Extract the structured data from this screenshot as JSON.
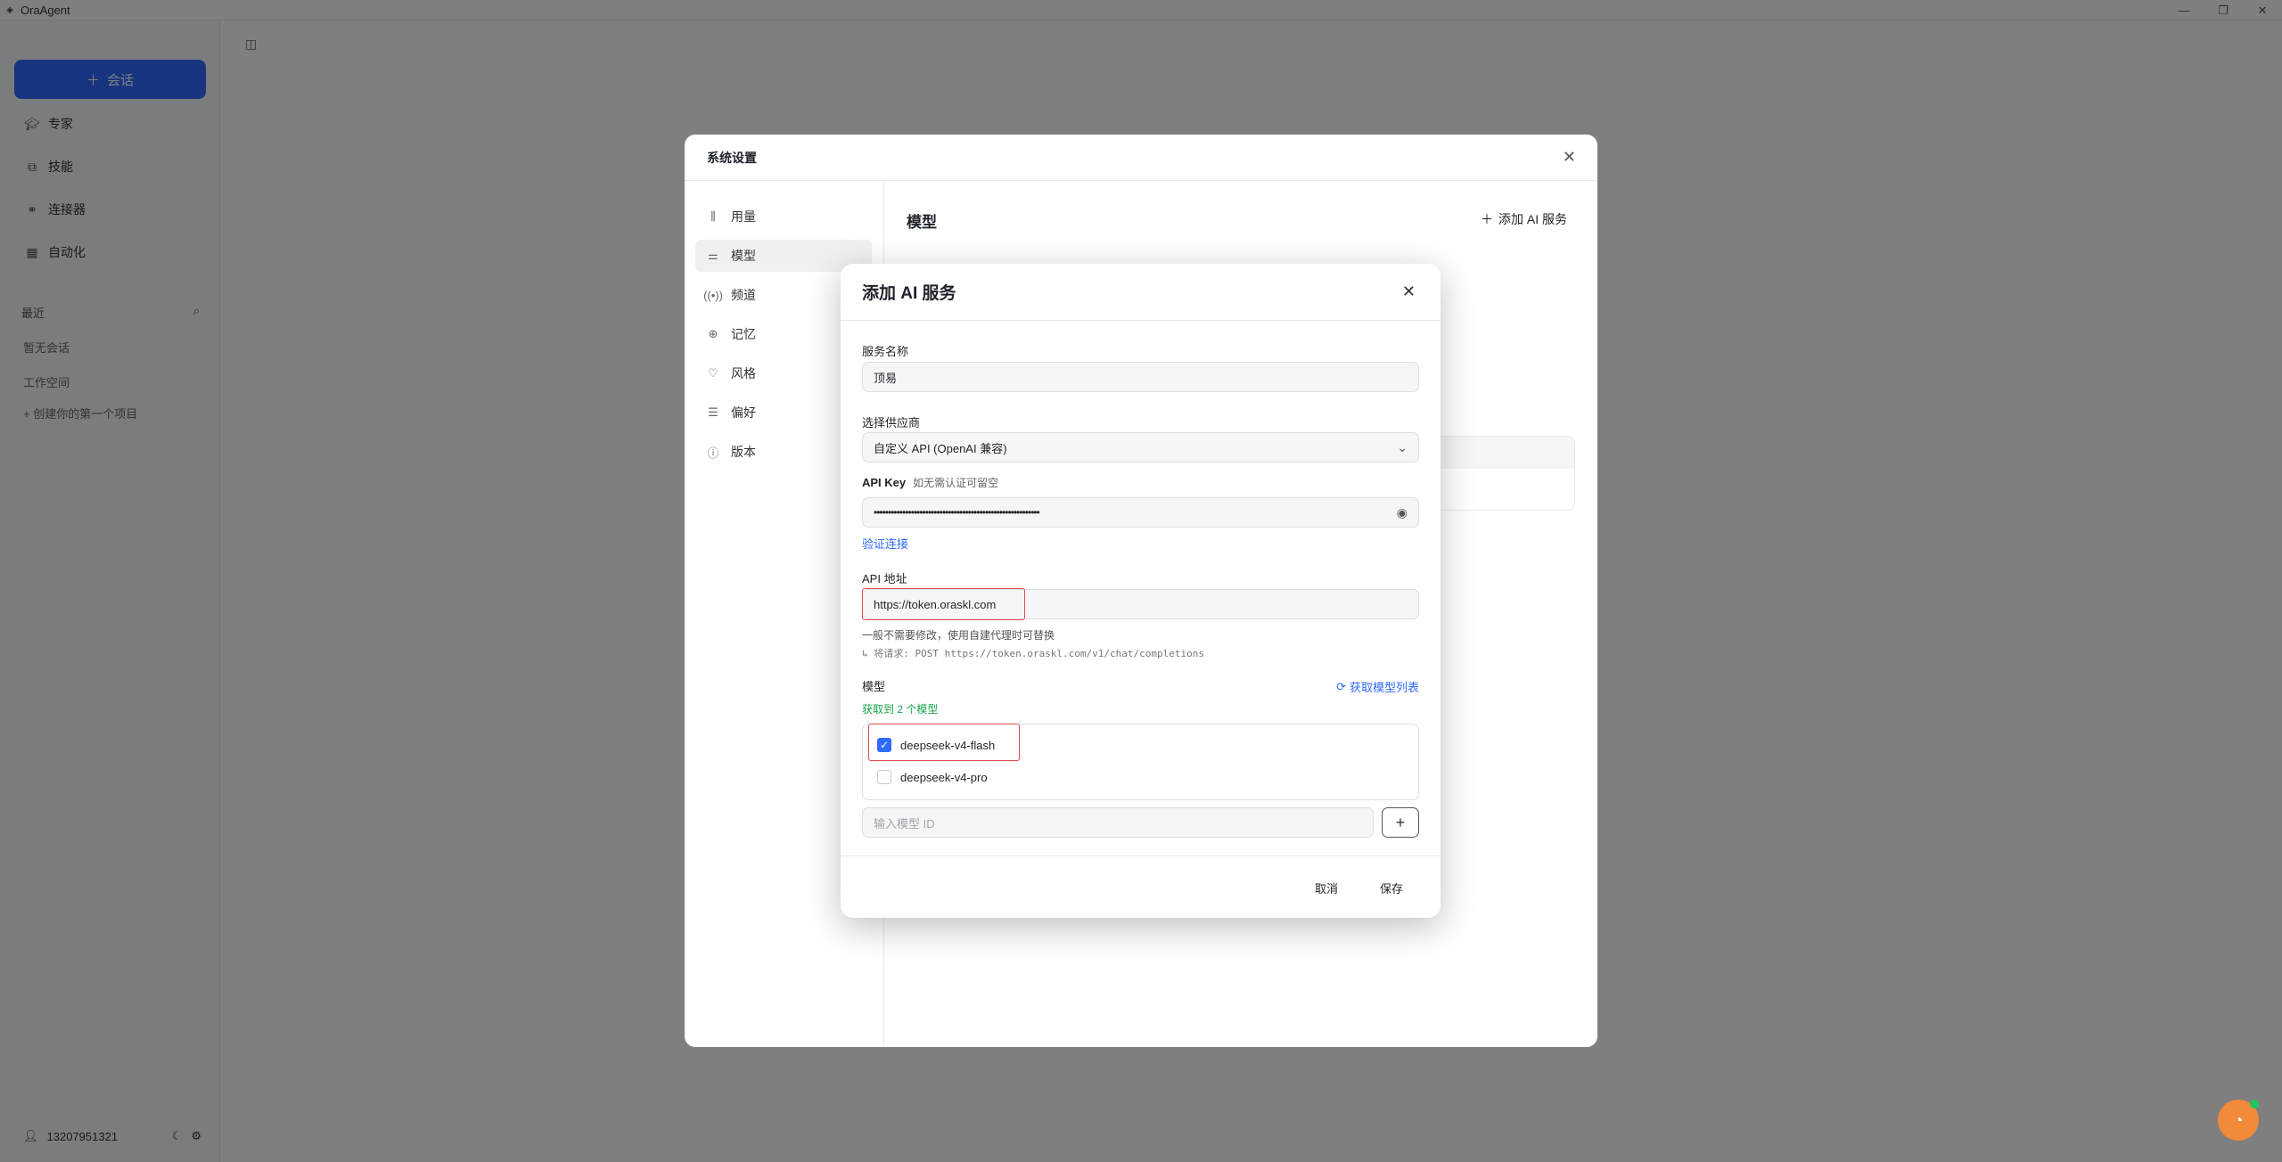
{
  "window": {
    "title": "OraAgent",
    "controls": {
      "minimize": "—",
      "restore": "❐",
      "close": "✕"
    }
  },
  "sidebar": {
    "new_chat": "会话",
    "items": [
      {
        "label": "专家",
        "icon": "graduation-cap-icon"
      },
      {
        "label": "技能",
        "icon": "puzzle-icon"
      },
      {
        "label": "连接器",
        "icon": "link-icon"
      },
      {
        "label": "自动化",
        "icon": "calendar-icon"
      }
    ],
    "recent_label": "最近",
    "no_session": "暂无会话",
    "workspace_label": "工作空间",
    "create_project": "+ 创建你的第一个项目",
    "user_phone": "13207951321"
  },
  "settings": {
    "title": "系统设置",
    "nav": [
      {
        "label": "用量",
        "icon": "bar-chart-icon"
      },
      {
        "label": "模型",
        "icon": "sliders-icon"
      },
      {
        "label": "频道",
        "icon": "radio-icon"
      },
      {
        "label": "记忆",
        "icon": "memory-icon"
      },
      {
        "label": "风格",
        "icon": "heart-icon"
      },
      {
        "label": "偏好",
        "icon": "list-settings-icon"
      },
      {
        "label": "版本",
        "icon": "info-icon"
      }
    ],
    "active_nav": "模型",
    "main_title": "模型",
    "add_service": "添加 AI 服务"
  },
  "dialog": {
    "title": "添加 AI 服务",
    "service_name_label": "服务名称",
    "service_name_value": "顶易",
    "provider_label": "选择供应商",
    "provider_value": "自定义 API (OpenAI 兼容)",
    "api_key_label": "API Key",
    "api_key_hint": "如无需认证可留空",
    "api_key_value": "••••••••••••••••••••••••••••••••••••••••••••••••••••••••••",
    "verify_link": "验证连接",
    "api_url_label": "API 地址",
    "api_url_value": "https://token.oraskl.com",
    "api_url_help": "一般不需要修改，使用自建代理时可替换",
    "api_url_request": "↳ 将请求: POST https://token.oraskl.com/v1/chat/completions",
    "models_label": "模型",
    "fetch_models": "获取模型列表",
    "fetched_count": "获取到 2 个模型",
    "models": [
      {
        "name": "deepseek-v4-flash",
        "checked": true
      },
      {
        "name": "deepseek-v4-pro",
        "checked": false
      }
    ],
    "model_id_placeholder": "输入模型 ID",
    "cancel": "取消",
    "save": "保存"
  }
}
